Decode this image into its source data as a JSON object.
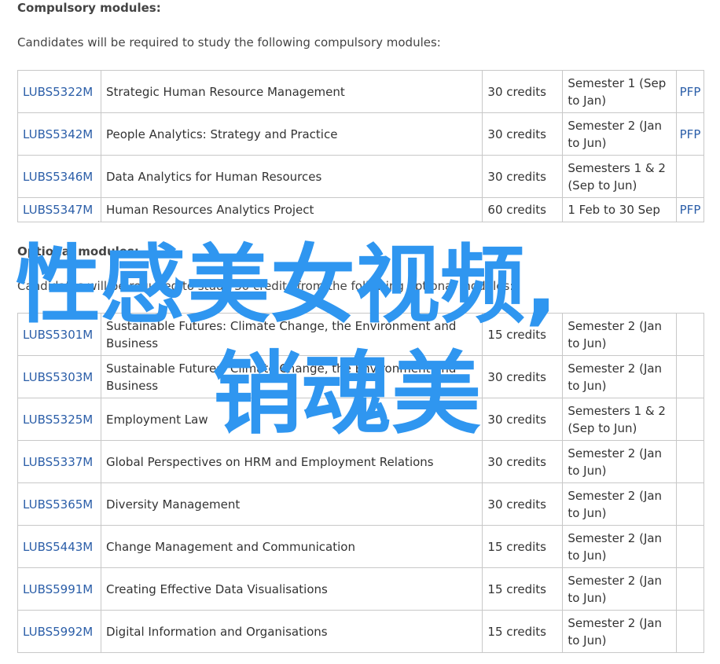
{
  "compulsory": {
    "heading": "Compulsory modules:",
    "intro": "Candidates will be required to study the following compulsory modules:",
    "rows": [
      {
        "code": "LUBS5322M",
        "title": "Strategic Human Resource Management",
        "credits": "30 credits",
        "semester": "Semester 1 (Sep to Jan)",
        "pfp": "PFP"
      },
      {
        "code": "LUBS5342M",
        "title": "People Analytics: Strategy and Practice",
        "credits": "30 credits",
        "semester": "Semester 2 (Jan to Jun)",
        "pfp": "PFP"
      },
      {
        "code": "LUBS5346M",
        "title": "Data Analytics for Human Resources",
        "credits": "30 credits",
        "semester": "Semesters 1 & 2 (Sep to Jun)",
        "pfp": ""
      },
      {
        "code": "LUBS5347M",
        "title": "Human Resources Analytics Project",
        "credits": "60 credits",
        "semester": "1 Feb to 30 Sep",
        "pfp": "PFP"
      }
    ]
  },
  "optional": {
    "heading": "Optional modules:",
    "intro": "Candidates will be required to study 30 credits from the following optional modules:",
    "rows": [
      {
        "code": "LUBS5301M",
        "title": "Sustainable Futures: Climate Change, the Environment and Business",
        "credits": "15 credits",
        "semester": "Semester 2 (Jan to Jun)"
      },
      {
        "code": "LUBS5303M",
        "title": "Sustainable Futures: Climate Change, the Environment and Business",
        "credits": "30 credits",
        "semester": "Semester 2 (Jan to Jun)"
      },
      {
        "code": "LUBS5325M",
        "title": "Employment Law",
        "credits": "30 credits",
        "semester": "Semesters 1 & 2 (Sep to Jun)"
      },
      {
        "code": "LUBS5337M",
        "title": "Global Perspectives on HRM and Employment Relations",
        "credits": "30 credits",
        "semester": "Semester 2 (Jan to Jun)"
      },
      {
        "code": "LUBS5365M",
        "title": "Diversity Management",
        "credits": "30 credits",
        "semester": "Semester 2 (Jan to Jun)"
      },
      {
        "code": "LUBS5443M",
        "title": "Change Management and Communication",
        "credits": "15 credits",
        "semester": "Semester 2 (Jan to Jun)"
      },
      {
        "code": "LUBS5991M",
        "title": "Creating Effective Data Visualisations",
        "credits": "15 credits",
        "semester": "Semester 2 (Jan to Jun)"
      },
      {
        "code": "LUBS5992M",
        "title": "Digital Information and Organisations",
        "credits": "15 credits",
        "semester": "Semester 2 (Jan to Jun)"
      }
    ]
  },
  "overlay": {
    "line1": "性感美女视频,",
    "line2": "销魂美"
  },
  "colors": {
    "link": "#2b5ea8",
    "overlay": "#2f96f0",
    "border": "#c8c8c8"
  }
}
